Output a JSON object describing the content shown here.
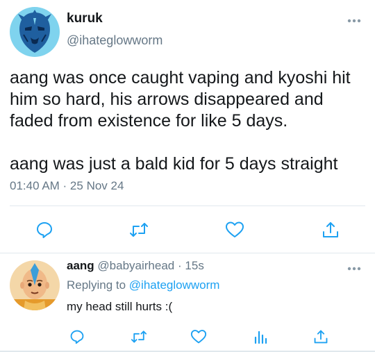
{
  "tweet": {
    "display_name": "kuruk",
    "handle": "@ihateglowworm",
    "text_line_1": "aang was once caught vaping and kyoshi hit him so hard, his arrows disappeared and faded from existence for like 5 days.",
    "text_line_2": "aang was just a bald kid for 5 days straight",
    "timestamp": "01:40 AM · 25 Nov 24",
    "avatar_icon": "kuruk-mask-avatar",
    "more_icon": "more-dots-icon",
    "actions": [
      "reply-icon",
      "retweet-icon",
      "like-icon",
      "share-icon"
    ]
  },
  "reply": {
    "display_name": "aang",
    "handle": "@babyairhead",
    "separator": "·",
    "time": "15s",
    "replying_prefix": "Replying to",
    "replying_to": "@ihateglowworm",
    "text": "my head still hurts :(",
    "avatar_icon": "aang-avatar",
    "more_icon": "more-dots-icon",
    "actions": [
      "reply-icon",
      "retweet-icon",
      "like-icon",
      "analytics-icon",
      "share-icon"
    ]
  },
  "colors": {
    "text": "#14171a",
    "secondary": "#657786",
    "accent": "#1da1f2",
    "icon": "#1da1f2",
    "divider": "#e1e8ed"
  }
}
